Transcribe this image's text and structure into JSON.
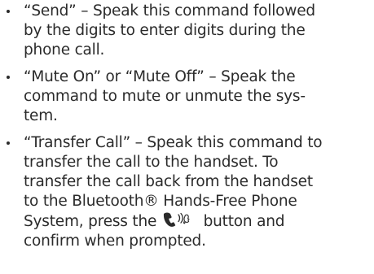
{
  "items": [
    {
      "lines": [
        "“Send” – Speak this command followed",
        "by the digits to enter digits during the",
        "phone call."
      ]
    },
    {
      "lines": [
        "“Mute On” or “Mute Off” – Speak the",
        "command to mute or unmute the sys-",
        "tem."
      ]
    },
    {
      "lines": [
        "“Transfer Call” – Speak this command to",
        "transfer the call to the handset. To",
        "transfer the call back from the handset",
        "to the Bluetooth® Hands-Free Phone"
      ],
      "pre_icon_text": "System, press the",
      "icon": "phone-voice-icon",
      "post_icon_text": "button and",
      "last_line": "confirm when prompted."
    }
  ]
}
